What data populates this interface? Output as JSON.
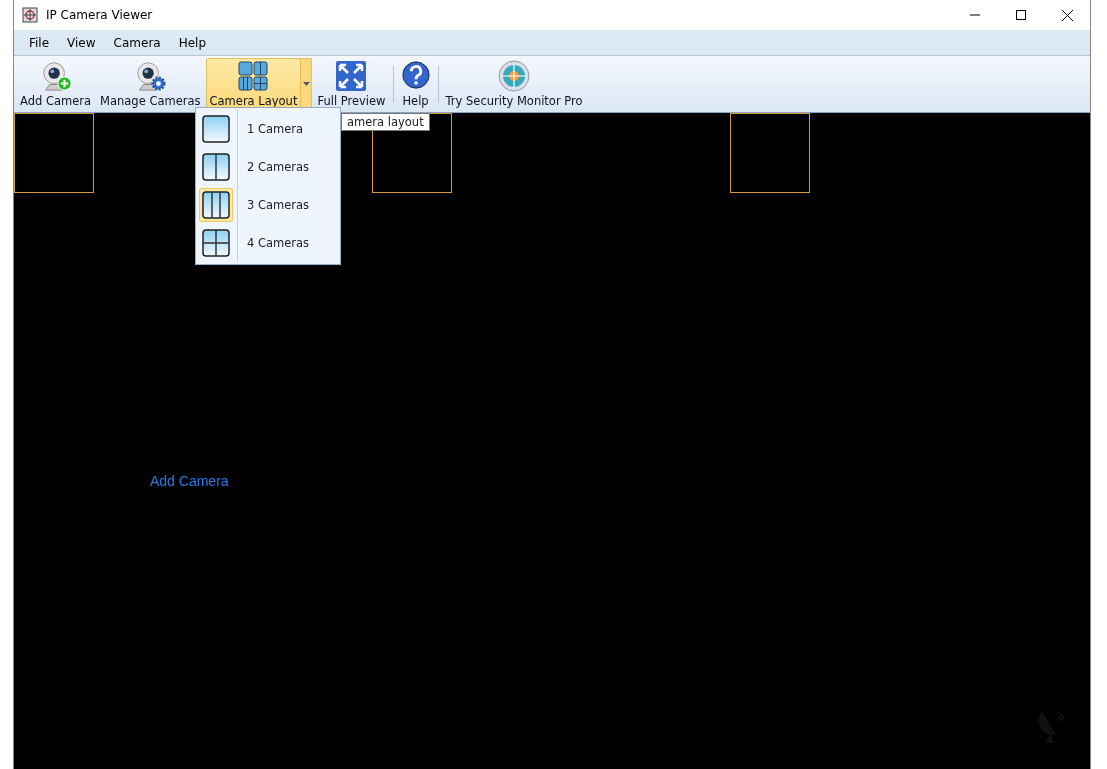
{
  "window": {
    "title": "IP Camera Viewer"
  },
  "menu": [
    "File",
    "View",
    "Camera",
    "Help"
  ],
  "toolbar": [
    {
      "label": "Add Camera",
      "kind": "add",
      "pressed": false
    },
    {
      "label": "Manage Cameras",
      "kind": "manage",
      "pressed": false
    },
    {
      "label": "Camera Layout",
      "kind": "layout",
      "pressed": true
    },
    {
      "label": "Full Preview",
      "kind": "full",
      "pressed": false
    },
    {
      "label": "Help",
      "kind": "help",
      "pressed": false
    },
    {
      "label": "Try Security Monitor Pro",
      "kind": "pro",
      "pressed": false
    }
  ],
  "layout_menu": [
    {
      "label": "1 Camera",
      "kind": "one",
      "selected": false
    },
    {
      "label": "2 Cameras",
      "kind": "two",
      "selected": false
    },
    {
      "label": "3 Cameras",
      "kind": "three",
      "selected": true
    },
    {
      "label": "4 Cameras",
      "kind": "four",
      "selected": false
    }
  ],
  "tooltip": "amera layout",
  "viewer": {
    "link": "Add Camera"
  }
}
